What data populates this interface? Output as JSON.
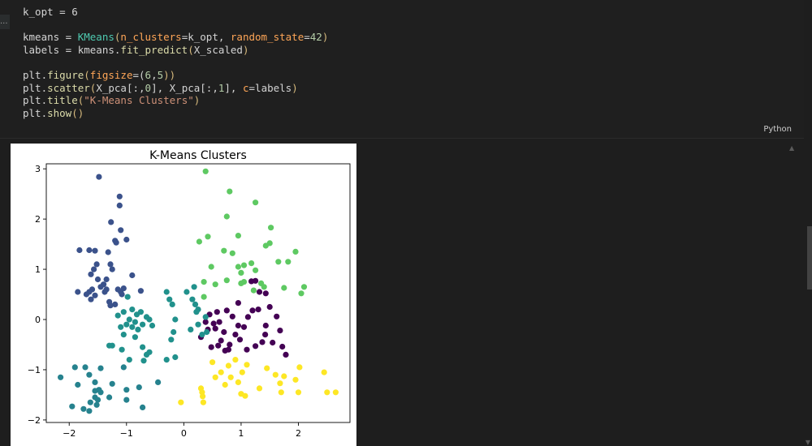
{
  "code_lines": [
    [
      {
        "t": "k_opt = 6",
        "c": "c-var"
      }
    ],
    [],
    [
      {
        "t": "kmeans = ",
        "c": "c-var"
      },
      {
        "t": "KMeans",
        "c": "c-cls"
      },
      {
        "t": "(",
        "c": "c-paren"
      },
      {
        "t": "n_clusters",
        "c": "c-param"
      },
      {
        "t": "=k_opt, ",
        "c": "c-var"
      },
      {
        "t": "random_state",
        "c": "c-param"
      },
      {
        "t": "=",
        "c": "c-var"
      },
      {
        "t": "42",
        "c": "c-num"
      },
      {
        "t": ")",
        "c": "c-paren"
      }
    ],
    [
      {
        "t": "labels = kmeans.",
        "c": "c-var"
      },
      {
        "t": "fit_predict",
        "c": "c-fn"
      },
      {
        "t": "(",
        "c": "c-paren"
      },
      {
        "t": "X_scaled",
        "c": "c-var"
      },
      {
        "t": ")",
        "c": "c-paren"
      }
    ],
    [],
    [
      {
        "t": "plt.",
        "c": "c-var"
      },
      {
        "t": "figure",
        "c": "c-fn"
      },
      {
        "t": "(",
        "c": "c-paren"
      },
      {
        "t": "figsize",
        "c": "c-param"
      },
      {
        "t": "=(",
        "c": "c-var"
      },
      {
        "t": "6",
        "c": "c-num"
      },
      {
        "t": ",",
        "c": "c-var"
      },
      {
        "t": "5",
        "c": "c-num"
      },
      {
        "t": "))",
        "c": "c-paren"
      }
    ],
    [
      {
        "t": "plt.",
        "c": "c-var"
      },
      {
        "t": "scatter",
        "c": "c-fn"
      },
      {
        "t": "(",
        "c": "c-paren"
      },
      {
        "t": "X_pca[:,",
        "c": "c-var"
      },
      {
        "t": "0",
        "c": "c-num"
      },
      {
        "t": "], X_pca[:,",
        "c": "c-var"
      },
      {
        "t": "1",
        "c": "c-num"
      },
      {
        "t": "], ",
        "c": "c-var"
      },
      {
        "t": "c",
        "c": "c-param"
      },
      {
        "t": "=labels",
        "c": "c-var"
      },
      {
        "t": ")",
        "c": "c-paren"
      }
    ],
    [
      {
        "t": "plt.",
        "c": "c-var"
      },
      {
        "t": "title",
        "c": "c-fn"
      },
      {
        "t": "(",
        "c": "c-paren"
      },
      {
        "t": "\"K-Means Clusters\"",
        "c": "c-str"
      },
      {
        "t": ")",
        "c": "c-paren"
      }
    ],
    [
      {
        "t": "plt.",
        "c": "c-var"
      },
      {
        "t": "show",
        "c": "c-fn"
      },
      {
        "t": "()",
        "c": "c-paren"
      }
    ]
  ],
  "cell_language": "Python",
  "cell_left_tab": "...",
  "chart_data": {
    "type": "scatter",
    "title": "K-Means Clusters",
    "xlabel": "",
    "ylabel": "",
    "xlim": [
      -2.4,
      2.9
    ],
    "ylim": [
      -2.05,
      3.1
    ],
    "xticks": [
      -2,
      -1,
      0,
      1,
      2
    ],
    "yticks": [
      -2,
      -1,
      0,
      1,
      2,
      3
    ],
    "grid": false,
    "colors": {
      "0": "#440154",
      "1": "#3b528b",
      "2": "#21918c",
      "3": "#5ec962",
      "4": "#fde725",
      "5": "#26828e"
    },
    "series": [
      {
        "label": 0,
        "points": [
          [
            0.75,
            0.18
          ],
          [
            0.85,
            0.06
          ],
          [
            0.62,
            -0.05
          ],
          [
            0.9,
            -0.3
          ],
          [
            0.7,
            -0.25
          ],
          [
            0.55,
            -0.18
          ],
          [
            0.48,
            -0.55
          ],
          [
            0.6,
            -0.52
          ],
          [
            0.72,
            -0.62
          ],
          [
            0.78,
            -0.6
          ],
          [
            0.98,
            -0.4
          ],
          [
            1.05,
            -0.15
          ],
          [
            1.12,
            0.05
          ],
          [
            1.2,
            0.18
          ],
          [
            1.3,
            0.2
          ],
          [
            1.25,
            0.77
          ],
          [
            1.43,
            0.52
          ],
          [
            1.5,
            0.25
          ],
          [
            1.62,
            0.06
          ],
          [
            1.43,
            -0.12
          ],
          [
            1.42,
            -0.3
          ],
          [
            1.37,
            -0.45
          ],
          [
            1.55,
            -0.46
          ],
          [
            1.68,
            -0.22
          ],
          [
            1.72,
            -0.54
          ],
          [
            1.78,
            -0.7
          ],
          [
            1.25,
            -0.53
          ],
          [
            1.1,
            -0.6
          ],
          [
            0.95,
            0.33
          ],
          [
            0.3,
            -0.35
          ],
          [
            0.38,
            -0.05
          ],
          [
            0.42,
            -0.2
          ],
          [
            0.45,
            0.1
          ],
          [
            0.52,
            -0.08
          ],
          [
            0.58,
            0.15
          ],
          [
            0.65,
            -0.42
          ],
          [
            0.8,
            -0.5
          ],
          [
            1.32,
            0.55
          ],
          [
            1.18,
            0.76
          ],
          [
            0.95,
            -0.12
          ]
        ]
      },
      {
        "label": 1,
        "points": [
          [
            -1.48,
            2.84
          ],
          [
            -1.12,
            2.45
          ],
          [
            -1.12,
            2.27
          ],
          [
            -1.27,
            1.94
          ],
          [
            -1.1,
            1.78
          ],
          [
            -1.2,
            1.57
          ],
          [
            -1.18,
            1.53
          ],
          [
            -1.0,
            1.59
          ],
          [
            -1.32,
            1.34
          ],
          [
            -1.65,
            1.38
          ],
          [
            -1.55,
            1.37
          ],
          [
            -1.82,
            1.38
          ],
          [
            -1.52,
            1.1
          ],
          [
            -1.28,
            1.1
          ],
          [
            -1.25,
            1.0
          ],
          [
            -1.57,
            1.0
          ],
          [
            -1.62,
            0.9
          ],
          [
            -1.5,
            0.8
          ],
          [
            -1.35,
            0.8
          ],
          [
            -1.4,
            0.7
          ],
          [
            -1.45,
            0.65
          ],
          [
            -1.35,
            0.6
          ],
          [
            -1.15,
            0.6
          ],
          [
            -1.1,
            0.55
          ],
          [
            -1.6,
            0.6
          ],
          [
            -1.65,
            0.55
          ],
          [
            -1.7,
            0.5
          ],
          [
            -1.85,
            0.55
          ],
          [
            -1.55,
            0.48
          ],
          [
            -1.62,
            0.4
          ],
          [
            -1.3,
            0.35
          ],
          [
            -1.2,
            0.3
          ],
          [
            -1.28,
            0.28
          ],
          [
            -1.08,
            0.5
          ],
          [
            -0.9,
            0.88
          ],
          [
            -0.75,
            0.57
          ],
          [
            -1.38,
            0.55
          ],
          [
            -1.05,
            0.62
          ]
        ]
      },
      {
        "label": 2,
        "points": [
          [
            -0.98,
            0.45
          ],
          [
            -0.9,
            0.2
          ],
          [
            -0.82,
            0.1
          ],
          [
            -1.05,
            0.15
          ],
          [
            -1.15,
            0.08
          ],
          [
            -0.75,
            0.15
          ],
          [
            -0.65,
            0.05
          ],
          [
            -0.95,
            0.0
          ],
          [
            -0.85,
            -0.05
          ],
          [
            -1.0,
            -0.1
          ],
          [
            -0.9,
            -0.15
          ],
          [
            -0.8,
            -0.2
          ],
          [
            -0.72,
            -0.1
          ],
          [
            -0.6,
            0.0
          ],
          [
            -1.1,
            -0.15
          ],
          [
            -1.05,
            -0.3
          ],
          [
            -0.85,
            -0.35
          ],
          [
            -0.55,
            -0.12
          ],
          [
            -1.25,
            -0.52
          ],
          [
            -1.3,
            -0.52
          ],
          [
            -1.08,
            -0.6
          ],
          [
            -0.72,
            -0.55
          ],
          [
            -0.6,
            -0.65
          ],
          [
            -0.65,
            -0.7
          ],
          [
            -0.95,
            -0.8
          ],
          [
            -0.7,
            -0.82
          ],
          [
            -0.3,
            0.55
          ],
          [
            -0.25,
            0.4
          ],
          [
            -0.2,
            0.3
          ],
          [
            -0.15,
            0.0
          ],
          [
            -0.18,
            -0.25
          ],
          [
            -0.22,
            -0.4
          ],
          [
            -0.15,
            -0.75
          ],
          [
            -0.3,
            -0.8
          ],
          [
            0.05,
            0.55
          ],
          [
            0.15,
            0.4
          ],
          [
            0.2,
            0.3
          ],
          [
            0.22,
            0.15
          ],
          [
            0.25,
            -0.1
          ],
          [
            0.32,
            -0.3
          ],
          [
            0.4,
            -0.25
          ],
          [
            0.18,
            0.65
          ],
          [
            0.38,
            0.05
          ],
          [
            0.25,
            0.2
          ],
          [
            0.12,
            -0.2
          ]
        ]
      },
      {
        "label": 3,
        "points": [
          [
            0.38,
            2.95
          ],
          [
            0.8,
            2.55
          ],
          [
            1.25,
            2.33
          ],
          [
            0.75,
            2.05
          ],
          [
            1.52,
            1.83
          ],
          [
            0.27,
            1.55
          ],
          [
            0.42,
            1.65
          ],
          [
            0.95,
            1.67
          ],
          [
            1.5,
            1.52
          ],
          [
            1.43,
            1.47
          ],
          [
            0.7,
            1.37
          ],
          [
            0.85,
            1.32
          ],
          [
            1.95,
            1.35
          ],
          [
            1.82,
            1.15
          ],
          [
            1.65,
            1.15
          ],
          [
            1.18,
            1.12
          ],
          [
            0.48,
            1.05
          ],
          [
            0.95,
            1.05
          ],
          [
            1.05,
            1.08
          ],
          [
            1.25,
            0.98
          ],
          [
            1.0,
            0.93
          ],
          [
            0.35,
            0.75
          ],
          [
            0.55,
            0.7
          ],
          [
            0.75,
            0.78
          ],
          [
            1.0,
            0.72
          ],
          [
            1.05,
            0.75
          ],
          [
            1.35,
            0.72
          ],
          [
            1.22,
            0.58
          ],
          [
            0.35,
            0.45
          ],
          [
            2.1,
            0.65
          ],
          [
            2.05,
            0.52
          ],
          [
            1.75,
            0.63
          ],
          [
            1.4,
            0.65
          ]
        ]
      },
      {
        "label": 4,
        "points": [
          [
            0.5,
            -0.85
          ],
          [
            0.9,
            -0.8
          ],
          [
            0.78,
            -0.92
          ],
          [
            1.1,
            -0.9
          ],
          [
            1.02,
            -1.05
          ],
          [
            0.65,
            -1.05
          ],
          [
            0.82,
            -1.15
          ],
          [
            0.95,
            -1.25
          ],
          [
            1.45,
            -0.97
          ],
          [
            1.6,
            -1.1
          ],
          [
            1.75,
            -1.13
          ],
          [
            1.68,
            -1.27
          ],
          [
            1.95,
            -1.2
          ],
          [
            2.02,
            -0.95
          ],
          [
            2.45,
            -1.05
          ],
          [
            2.0,
            -1.45
          ],
          [
            2.5,
            -1.45
          ],
          [
            2.65,
            -1.45
          ],
          [
            0.3,
            -1.37
          ],
          [
            0.32,
            -1.45
          ],
          [
            0.33,
            -1.53
          ],
          [
            0.34,
            -1.65
          ],
          [
            -0.05,
            -1.65
          ],
          [
            1.0,
            -1.48
          ],
          [
            1.07,
            -1.52
          ],
          [
            1.32,
            -1.37
          ],
          [
            1.7,
            -1.45
          ],
          [
            0.55,
            -1.15
          ],
          [
            0.72,
            -1.3
          ]
        ]
      },
      {
        "label": 5,
        "points": [
          [
            -2.15,
            -1.15
          ],
          [
            -1.9,
            -0.95
          ],
          [
            -1.72,
            -0.95
          ],
          [
            -1.85,
            -1.3
          ],
          [
            -1.65,
            -1.1
          ],
          [
            -1.45,
            -0.97
          ],
          [
            -1.55,
            -1.25
          ],
          [
            -1.48,
            -1.4
          ],
          [
            -1.55,
            -1.55
          ],
          [
            -1.45,
            -1.45
          ],
          [
            -1.5,
            -1.6
          ],
          [
            -1.52,
            -1.7
          ],
          [
            -1.63,
            -1.65
          ],
          [
            -1.65,
            -1.82
          ],
          [
            -1.75,
            -1.78
          ],
          [
            -1.95,
            -1.73
          ],
          [
            -1.3,
            -1.55
          ],
          [
            -1.25,
            -1.28
          ],
          [
            -1.05,
            -0.95
          ],
          [
            -1.0,
            -1.4
          ],
          [
            -1.0,
            -1.6
          ],
          [
            -0.78,
            -1.35
          ],
          [
            -0.72,
            -1.75
          ],
          [
            -0.45,
            -1.25
          ],
          [
            -1.55,
            -1.42
          ]
        ]
      }
    ]
  }
}
